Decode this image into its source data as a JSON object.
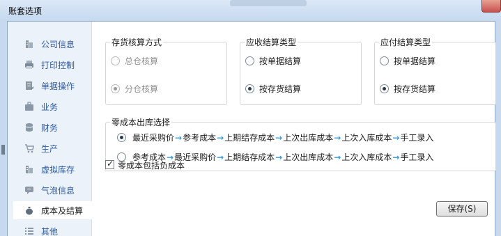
{
  "window": {
    "title": "账套选项"
  },
  "sidebar": {
    "items": [
      {
        "label": "公司信息",
        "icon": "building-icon"
      },
      {
        "label": "打印控制",
        "icon": "printer-icon"
      },
      {
        "label": "单据操作",
        "icon": "document-edit-icon"
      },
      {
        "label": "业务",
        "icon": "briefcase-icon"
      },
      {
        "label": "财务",
        "icon": "database-icon"
      },
      {
        "label": "生产",
        "icon": "cart-icon"
      },
      {
        "label": "虚拟库存",
        "icon": "building-icon"
      },
      {
        "label": "气泡信息",
        "icon": "chat-bubble-icon"
      },
      {
        "label": "成本及结算",
        "icon": "money-bag-icon",
        "selected": true
      },
      {
        "label": "其他",
        "icon": "list-icon"
      }
    ]
  },
  "inventory_method": {
    "legend": "存货核算方式",
    "options": [
      {
        "label": "总仓核算",
        "checked": false,
        "disabled": true
      },
      {
        "label": "分仓核算",
        "checked": true,
        "disabled": true
      }
    ]
  },
  "receivable_type": {
    "legend": "应收结算类型",
    "options": [
      {
        "label": "按单据结算",
        "checked": false
      },
      {
        "label": "按存货结算",
        "checked": true
      }
    ]
  },
  "payable_type": {
    "legend": "应付结算类型",
    "options": [
      {
        "label": "按单据结算",
        "checked": false
      },
      {
        "label": "按存货结算",
        "checked": true
      }
    ]
  },
  "zero_cost": {
    "legend": "零成本出库选择",
    "options": [
      {
        "steps": [
          "最近采购价",
          "参考成本",
          "上期结存成本",
          "上次出库成本",
          "上次入库成本",
          "手工录入"
        ],
        "checked": true
      },
      {
        "steps": [
          "参考成本",
          "最近采购价",
          "上期结存成本",
          "上次出库成本",
          "上次入库成本",
          "手工录入"
        ],
        "checked": false
      }
    ],
    "arrow": "→"
  },
  "negative_cost": {
    "label": "零成本包括负成本",
    "checked": true
  },
  "save_button": {
    "label": "保存(S)"
  },
  "colors": {
    "nav_text": "#2d5aa0",
    "arrow": "#3b9ad8",
    "sidebar_bg": "#ecf2fa"
  }
}
